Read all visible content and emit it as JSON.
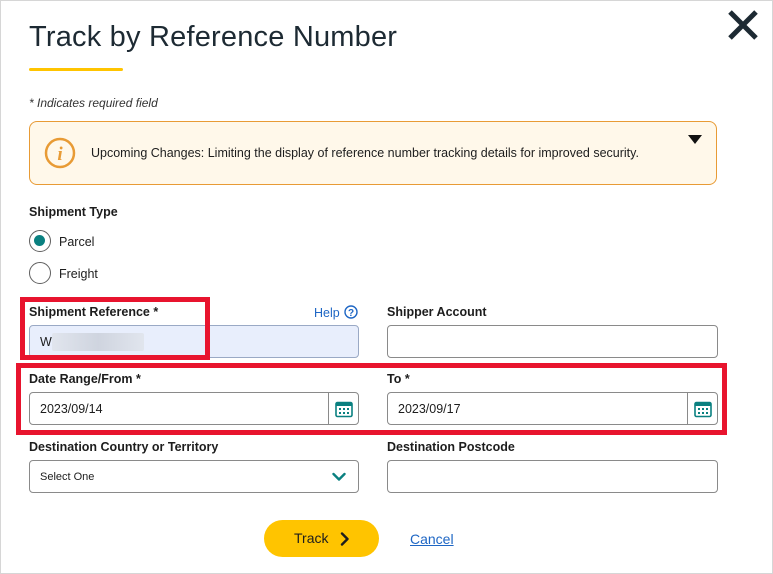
{
  "dialog": {
    "title": "Track by Reference Number",
    "required_note": "* Indicates required field",
    "close_icon": "close-icon"
  },
  "alert": {
    "icon": "info-icon",
    "text": "Upcoming Changes: Limiting the display of reference number tracking details for improved security.",
    "toggle_icon": "caret-down-icon",
    "accent_color": "#e89b35"
  },
  "shipment_type": {
    "label": "Shipment Type",
    "options": [
      {
        "label": "Parcel",
        "selected": true
      },
      {
        "label": "Freight",
        "selected": false
      }
    ]
  },
  "shipment_reference": {
    "label": "Shipment Reference *",
    "help_label": "Help",
    "value": "W"
  },
  "shipper_account": {
    "label": "Shipper Account",
    "value": ""
  },
  "date_range": {
    "from_label": "Date Range/From *",
    "from_value": "2023/09/14",
    "to_label": "To *",
    "to_value": "2023/09/17",
    "calendar_icon": "calendar-icon"
  },
  "destination_country": {
    "label": "Destination Country or Territory",
    "selected": "Select One"
  },
  "destination_postcode": {
    "label": "Destination Postcode",
    "value": ""
  },
  "actions": {
    "track_label": "Track",
    "cancel_label": "Cancel"
  },
  "colors": {
    "brand_yellow": "#ffc400",
    "teal": "#0a8080",
    "link_blue": "#1e66c4",
    "highlight_red": "#e8142e"
  }
}
